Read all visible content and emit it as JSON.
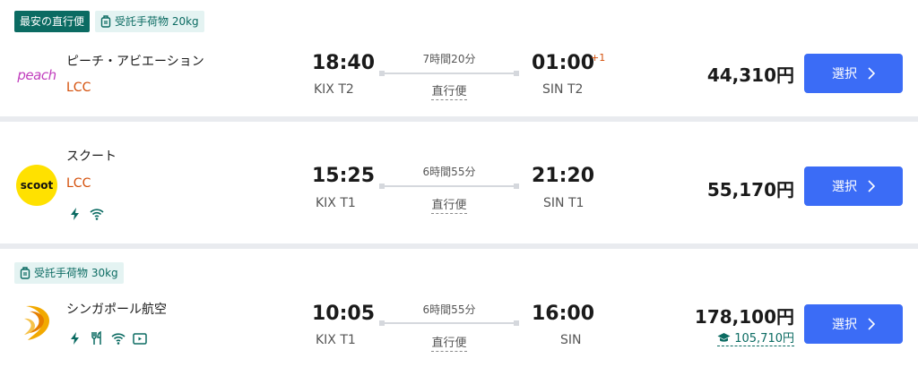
{
  "flights": [
    {
      "badges": [
        "最安の直行便",
        "受託手荷物 20kg"
      ],
      "logo_text": "peach",
      "airline": "ピーチ・アビエーション",
      "type": "LCC",
      "dep_time": "18:40",
      "dep_airport": "KIX T2",
      "duration": "7時間20分",
      "direct": "直行便",
      "arr_time": "01:00",
      "arr_plus": "+1",
      "arr_airport": "SIN T2",
      "price": "44,310円",
      "select": "選択"
    },
    {
      "logo_text": "scoot",
      "airline": "スクート",
      "type": "LCC",
      "amenities": [
        "power-icon",
        "wifi-icon"
      ],
      "dep_time": "15:25",
      "dep_airport": "KIX T1",
      "duration": "6時間55分",
      "direct": "直行便",
      "arr_time": "21:20",
      "arr_airport": "SIN T1",
      "price": "55,170円",
      "select": "選択"
    },
    {
      "badges": [
        "受託手荷物 30kg"
      ],
      "airline": "シンガポール航空",
      "amenities": [
        "power-icon",
        "meal-icon",
        "wifi-icon",
        "entertainment-icon"
      ],
      "dep_time": "10:05",
      "dep_airport": "KIX T1",
      "duration": "6時間55分",
      "direct": "直行便",
      "arr_time": "16:00",
      "arr_airport": "SIN",
      "price": "178,100円",
      "student_price": "105,710円",
      "select": "選択"
    }
  ],
  "colors": {
    "accent": "#3b6cf6",
    "teal": "#0b6b62",
    "lcc": "#d44f0a",
    "separator": "#e9ebef"
  }
}
